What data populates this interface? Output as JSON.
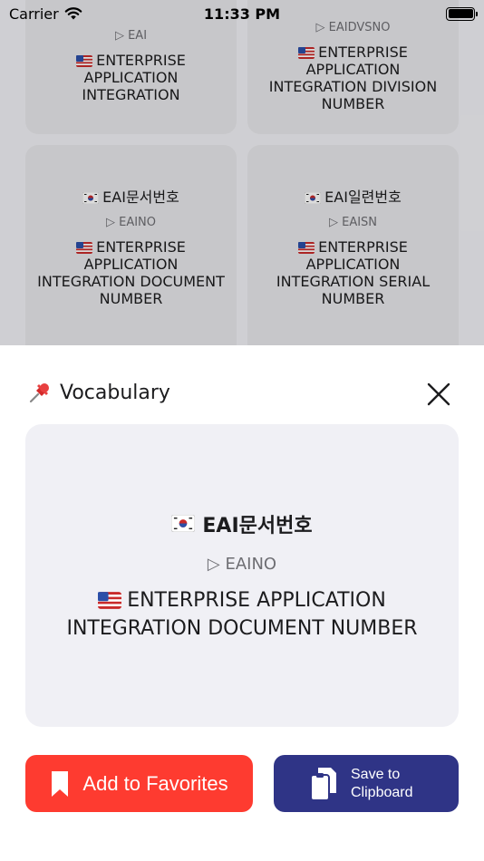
{
  "status_bar": {
    "carrier": "Carrier",
    "time": "11:33 PM"
  },
  "background_cards": [
    {
      "ko": "",
      "code": "▷ EAI",
      "en": "ENTERPRISE APPLICATION INTEGRATION"
    },
    {
      "ko": "",
      "code": "▷ EAIDVSNO",
      "en": "ENTERPRISE APPLICATION INTEGRATION DIVISION NUMBER"
    },
    {
      "ko": "EAI문서번호",
      "code": "▷ EAINO",
      "en": "ENTERPRISE APPLICATION INTEGRATION DOCUMENT NUMBER"
    },
    {
      "ko": "EAI일련번호",
      "code": "▷ EAISN",
      "en": "ENTERPRISE APPLICATION INTEGRATION SERIAL NUMBER"
    }
  ],
  "sheet": {
    "title": "Vocabulary",
    "vocab": {
      "ko": "EAI문서번호",
      "code": "▷ EAINO",
      "en": "ENTERPRISE APPLICATION INTEGRATION DOCUMENT NUMBER"
    },
    "buttons": {
      "favorites_label": "Add to Favorites",
      "clipboard_label_line1": "Save to",
      "clipboard_label_line2": "Clipboard"
    }
  },
  "colors": {
    "favorites_bg": "#fe3b30",
    "clipboard_bg": "#2f3486",
    "card_bg": "#f0f0f5"
  },
  "icons": {
    "pin": "pushpin-icon",
    "close": "close-icon",
    "bookmark": "bookmark-icon",
    "clipboard": "clipboard-icon",
    "korea_flag": "korea-flag-icon",
    "us_flag": "us-flag-icon"
  }
}
